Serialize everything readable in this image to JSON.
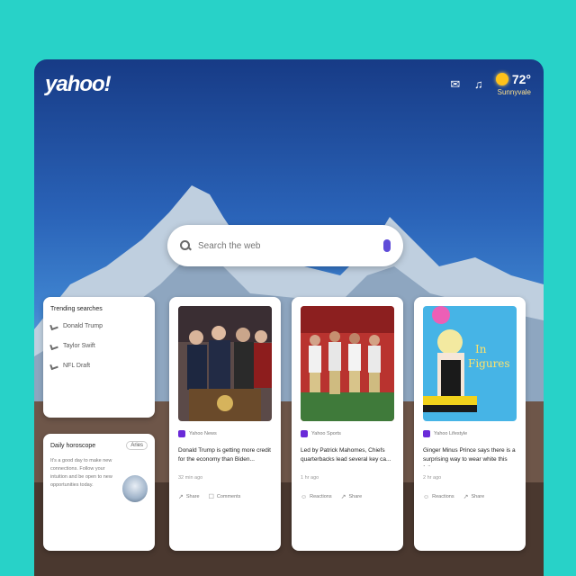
{
  "header": {
    "logo": "yahoo!",
    "weather": {
      "temp": "72°",
      "city": "Sunnyvale"
    },
    "icons": [
      "mail-icon",
      "bell-icon"
    ]
  },
  "search": {
    "placeholder": "Search the web"
  },
  "trending": {
    "title": "Trending searches",
    "items": [
      "Donald Trump",
      "Taylor Swift",
      "NFL Draft"
    ]
  },
  "horoscope": {
    "title": "Daily horoscope",
    "sign": "Aries",
    "text": "It's a good day to make new connections. Follow your intuition and be open to new opportunities today."
  },
  "news": [
    {
      "source": "Yahoo News",
      "headline": "Donald Trump is getting more credit for the economy than Biden...",
      "time": "32 min ago",
      "action1": "Share",
      "action2": "Comments"
    },
    {
      "source": "Yahoo Sports",
      "headline": "Led by Patrick Mahomes, Chiefs quarterbacks lead several key ca...",
      "time": "1 hr ago",
      "action1": "Reactions",
      "action2": "Share"
    },
    {
      "source": "Yahoo Lifestyle",
      "headline": "Ginger Minus Prince says there is a surprising way to wear white this fall...",
      "time": "2 hr ago",
      "action1": "Reactions",
      "action2": "Share"
    }
  ],
  "colors": {
    "background": "#28d2c8",
    "brand": "#6a2ad8"
  }
}
